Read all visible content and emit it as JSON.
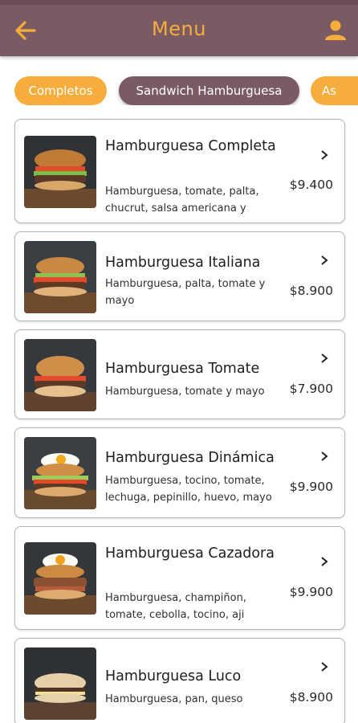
{
  "header": {
    "title": "Menu",
    "back_icon": "arrow-left-icon",
    "user_icon": "person-icon",
    "bar_color": "#7b5b63",
    "accent_color": "#f6ad3b"
  },
  "categories": [
    {
      "label": "Completos",
      "active": false
    },
    {
      "label": "Sandwich Hamburguesa",
      "active": true
    },
    {
      "label": "As",
      "active": false
    }
  ],
  "items": [
    {
      "name": "Hamburguesa Completa",
      "description": "Hamburguesa, tomate, palta, chucrut, salsa americana y",
      "price": "$9.400"
    },
    {
      "name": "Hamburguesa Italiana",
      "description": "Hamburguesa, palta, tomate y mayo",
      "price": "$8.900"
    },
    {
      "name": "Hamburguesa Tomate",
      "description": "Hamburguesa, tomate y mayo",
      "price": "$7.900"
    },
    {
      "name": "Hamburguesa Dinámica",
      "description": "Hamburguesa, tocino, tomate, lechuga, pepinillo, huevo, mayo",
      "price": "$9.900"
    },
    {
      "name": "Hamburguesa Cazadora",
      "description": "Hamburguesa, champiñon, tomate, cebolla, tocino, aji",
      "price": "$9.900"
    },
    {
      "name": "Hamburguesa Luco",
      "description": "Hamburguesa, pan, queso",
      "price": "$8.900"
    }
  ]
}
